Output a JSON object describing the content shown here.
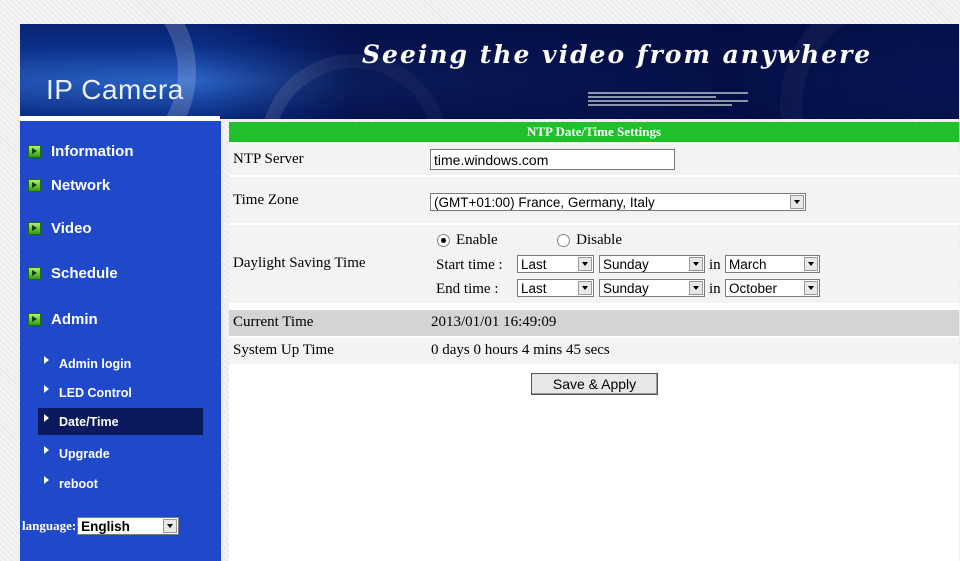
{
  "banner": {
    "slogan": "Seeing the video from anywhere",
    "brand": "IP Camera"
  },
  "sidebar": {
    "menu": [
      {
        "label": "Information",
        "icon": "green-arrow-icon"
      },
      {
        "label": "Network",
        "icon": "green-arrow-icon"
      },
      {
        "label": "Video",
        "icon": "green-arrow-icon"
      },
      {
        "label": "Schedule",
        "icon": "green-arrow-icon"
      },
      {
        "label": "Admin",
        "icon": "green-arrow-icon"
      }
    ],
    "submenu": [
      {
        "label": "Admin login"
      },
      {
        "label": "LED Control"
      },
      {
        "label": "Date/Time",
        "active": true
      },
      {
        "label": "Upgrade"
      },
      {
        "label": "reboot"
      }
    ],
    "language_label": "language:",
    "language_value": "English"
  },
  "form": {
    "header": "NTP Date/Time Settings",
    "ntp_server_label": "NTP Server",
    "ntp_server_value": "time.windows.com",
    "time_zone_label": "Time Zone",
    "time_zone_value": "(GMT+01:00) France, Germany, Italy",
    "dst_label": "Daylight Saving Time",
    "dst_enable_label": "Enable",
    "dst_disable_label": "Disable",
    "dst_selected": "Enable",
    "start_time_label": "Start time :",
    "end_time_label": "End time :",
    "in_label": "in",
    "start_week": "Last",
    "start_day": "Sunday",
    "start_month": "March",
    "end_week": "Last",
    "end_day": "Sunday",
    "end_month": "October",
    "current_time_label": "Current Time",
    "current_time_value": "2013/01/01 16:49:09",
    "uptime_label": "System Up Time",
    "uptime_value": "0 days 0 hours 4 mins 45 secs",
    "save_button_label": "Save & Apply"
  },
  "colors": {
    "sidebar_bg": "#1f49c9",
    "header_green": "#1fc02a",
    "active_item_bg": "#0b1a5e",
    "row_gray": "#d4d4d4"
  }
}
